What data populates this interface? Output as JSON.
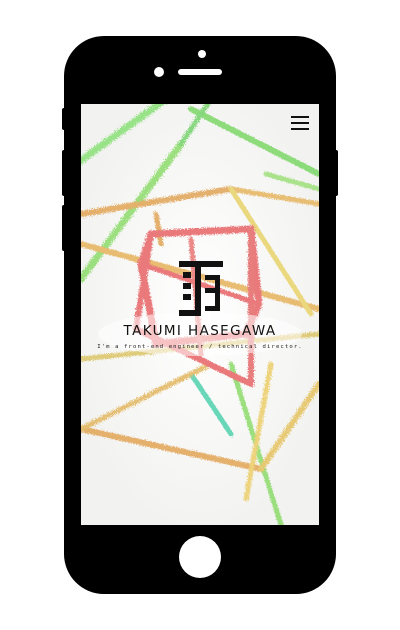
{
  "profile": {
    "name": "TAKUMI HASEGAWA",
    "tagline": "I'm a front-end engineer / technical director."
  },
  "menu": {
    "icon": "hamburger-menu-icon"
  },
  "logo": {
    "icon": "th-monogram-logo"
  },
  "colors": {
    "phone": "#000000",
    "screen_bg": "#f7f7f6",
    "text": "#111111",
    "stroke_red": "#e8686a",
    "stroke_orange": "#e2a75a",
    "stroke_yellow": "#e9d46e",
    "stroke_green": "#7fd86a",
    "stroke_teal": "#54d3b0"
  }
}
